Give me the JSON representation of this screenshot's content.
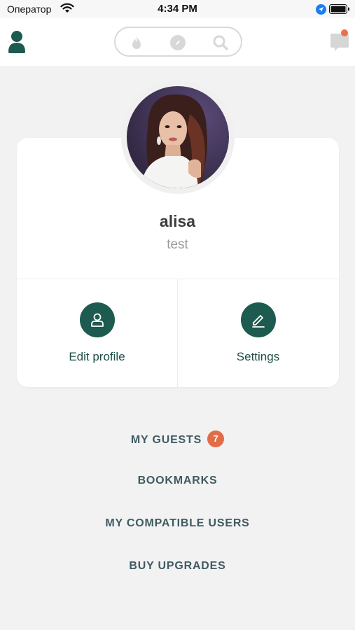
{
  "status_bar": {
    "carrier": "Оператор",
    "time": "4:34 PM"
  },
  "nav": {
    "icons": [
      "profile-icon",
      "fire-icon",
      "compass-icon",
      "search-icon",
      "chat-icon"
    ],
    "notification_color": "#e9704a"
  },
  "profile": {
    "name": "alisa",
    "subtitle": "test"
  },
  "actions": {
    "edit_label": "Edit profile",
    "settings_label": "Settings"
  },
  "menu": {
    "guests_label": "MY GUESTS",
    "guests_count": "7",
    "bookmarks_label": "BOOKMARKS",
    "compatible_label": "MY COMPATIBLE USERS",
    "upgrades_label": "BUY UPGRADES"
  },
  "colors": {
    "brand": "#1d5a4f",
    "badge": "#e26c48",
    "background": "#f2f2f2"
  }
}
